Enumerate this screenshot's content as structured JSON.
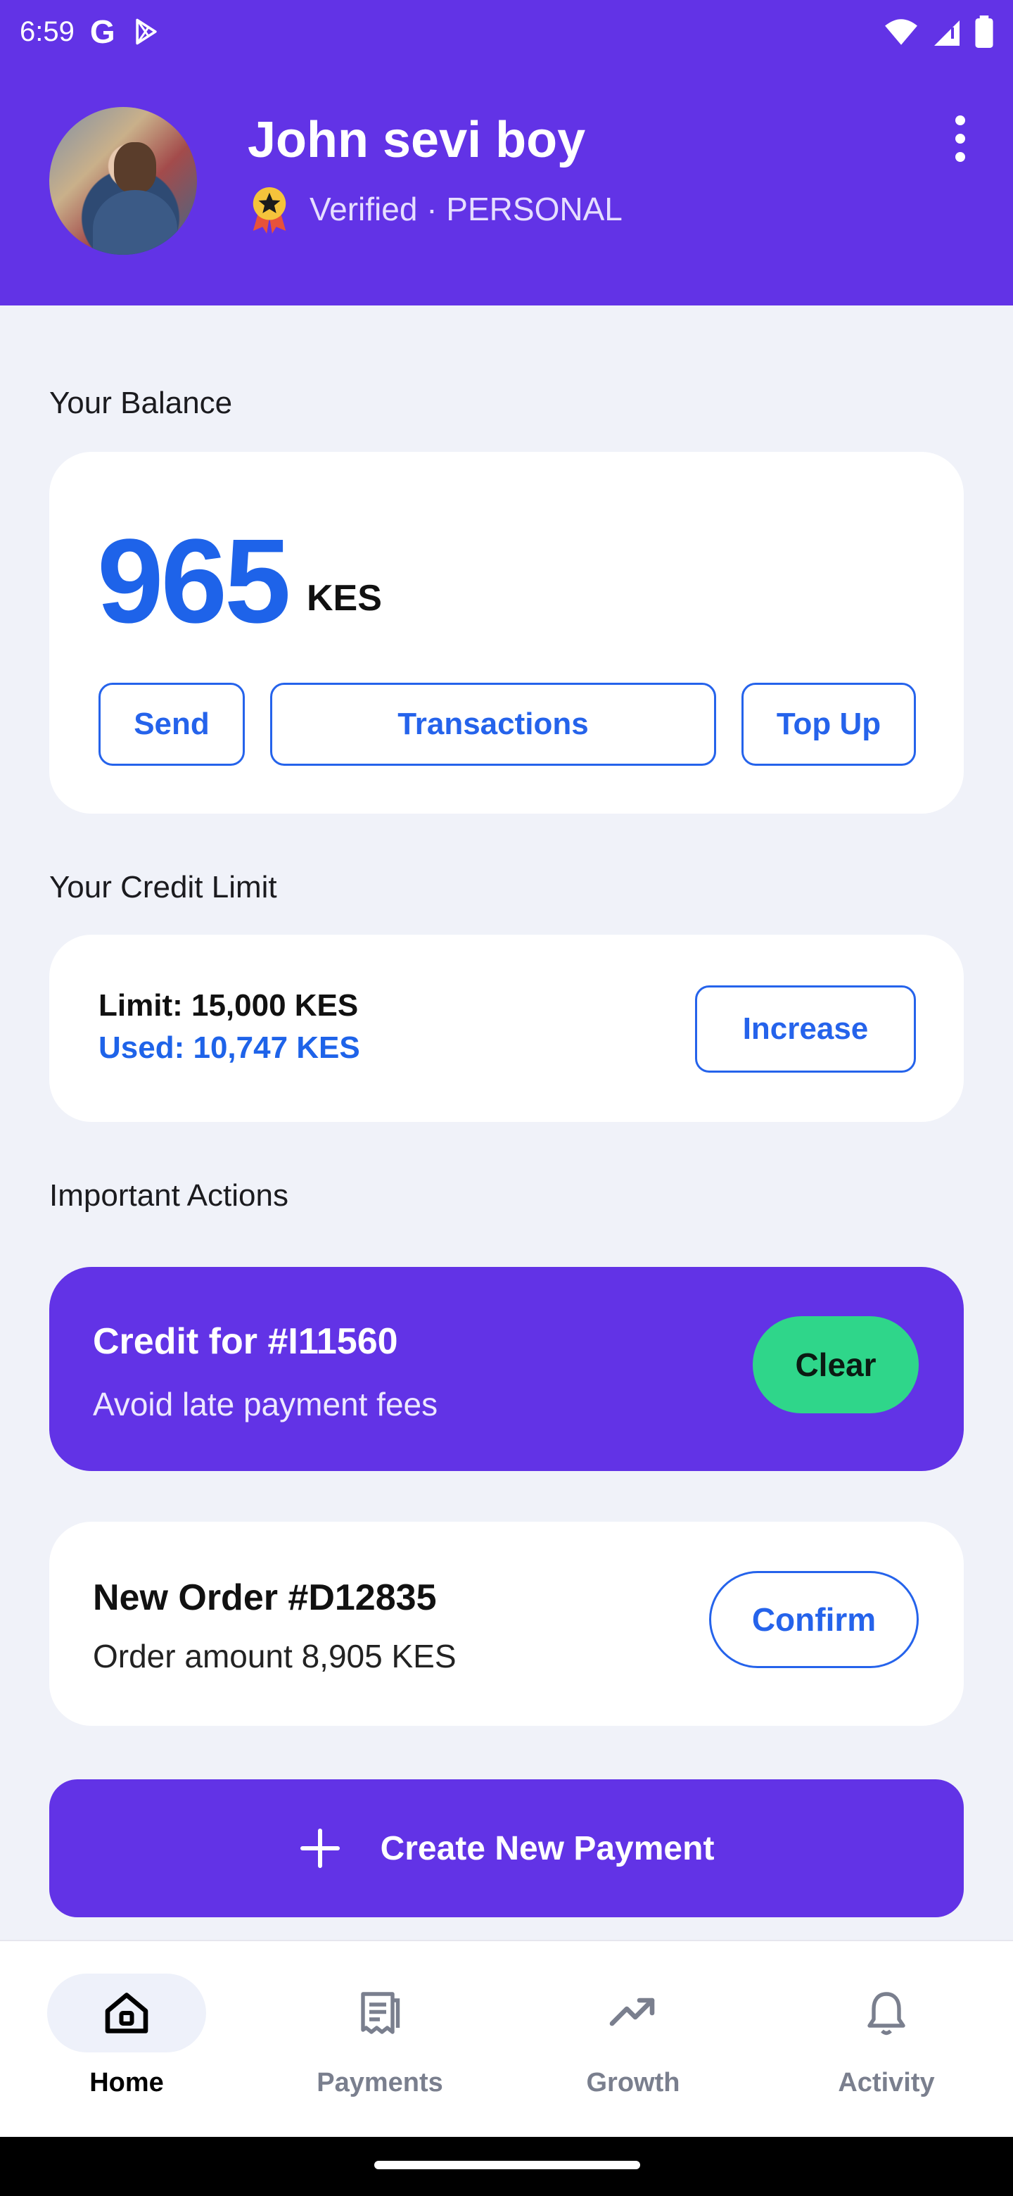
{
  "status_bar": {
    "time": "6:59"
  },
  "colors": {
    "primary": "#6233E6",
    "accent_blue": "#1E63E9",
    "success_green": "#2FD68A",
    "background": "#F0F2F9"
  },
  "profile": {
    "name": "John sevi boy",
    "status": "Verified · PERSONAL"
  },
  "balance": {
    "section_label": "Your Balance",
    "amount": "965",
    "currency": "KES",
    "buttons": {
      "send": "Send",
      "transactions": "Transactions",
      "top_up": "Top Up"
    }
  },
  "credit": {
    "section_label": "Your Credit Limit",
    "limit": "Limit: 15,000 KES",
    "used": "Used: 10,747 KES",
    "increase_label": "Increase"
  },
  "actions": {
    "section_label": "Important Actions",
    "credit_item": {
      "title": "Credit for #I11560",
      "subtitle": "Avoid late payment fees",
      "button": "Clear"
    },
    "order_item": {
      "title": "New Order #D12835",
      "subtitle": "Order amount 8,905 KES",
      "button": "Confirm"
    }
  },
  "create_payment_label": "Create New Payment",
  "bottom_nav": {
    "items": [
      {
        "label": "Home",
        "icon": "home-icon",
        "active": true
      },
      {
        "label": "Payments",
        "icon": "receipt-icon",
        "active": false
      },
      {
        "label": "Growth",
        "icon": "trending-up-icon",
        "active": false
      },
      {
        "label": "Activity",
        "icon": "bell-icon",
        "active": false
      }
    ]
  }
}
